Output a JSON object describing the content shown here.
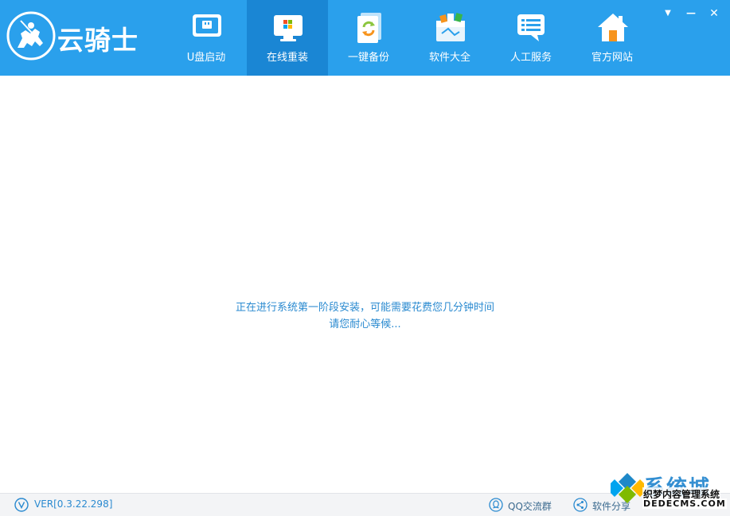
{
  "app": {
    "name": "云骑士"
  },
  "nav": {
    "tabs": [
      {
        "label": "U盘启动",
        "icon": "usb-boot-icon"
      },
      {
        "label": "在线重装",
        "icon": "online-reinstall-icon",
        "active": true
      },
      {
        "label": "一键备份",
        "icon": "backup-icon"
      },
      {
        "label": "软件大全",
        "icon": "software-box-icon"
      },
      {
        "label": "人工服务",
        "icon": "chat-service-icon"
      },
      {
        "label": "官方网站",
        "icon": "home-icon"
      }
    ]
  },
  "window_controls": {
    "menu": "▼",
    "minimize": "—",
    "close": "✕"
  },
  "main": {
    "status_line1": "正在进行系统第一阶段安装，可能需要花费您几分钟时间",
    "status_line2": "请您耐心等候..."
  },
  "footer": {
    "version": "VER[0.3.22.298]",
    "qq_group": "QQ交流群",
    "share": "软件分享"
  },
  "watermark": {
    "brand": "系统城",
    "line1": "织梦内容管理系统",
    "line2": "DEDECMS.COM"
  },
  "colors": {
    "header": "#2aa0ec",
    "active_tab": "#1a86d4",
    "status_text": "#2a8ad0",
    "footer_bg": "#f3f4f6"
  }
}
